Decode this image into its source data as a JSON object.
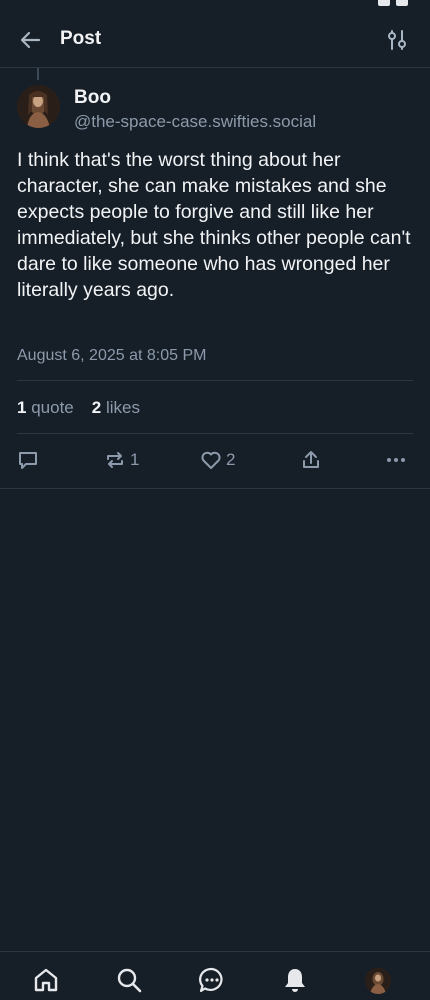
{
  "header": {
    "title": "Post"
  },
  "post": {
    "author_name": "Boo",
    "author_handle": "@the-space-case.swifties.social",
    "text": "I think that's the worst thing about her character, she can make mistakes and she expects people to forgive and still like her immediately, but she thinks other people can't dare to like someone who has wronged her literally years ago.",
    "date": "August 6, 2025 at 8:05 PM",
    "stats": {
      "quotes_count": "1",
      "quotes_label": "quote",
      "likes_count": "2",
      "likes_label": "likes"
    },
    "actions": {
      "repost_count": "1",
      "like_count": "2"
    }
  },
  "colors": {
    "background": "#161e27",
    "text": "#f1f3f5",
    "muted": "#8c9aab",
    "divider": "#2b3642"
  },
  "icons": [
    "back-arrow-icon",
    "filter-icon",
    "reply-icon",
    "repost-icon",
    "heart-icon",
    "share-icon",
    "more-icon",
    "home-icon",
    "search-icon",
    "chat-icon",
    "bell-icon"
  ]
}
